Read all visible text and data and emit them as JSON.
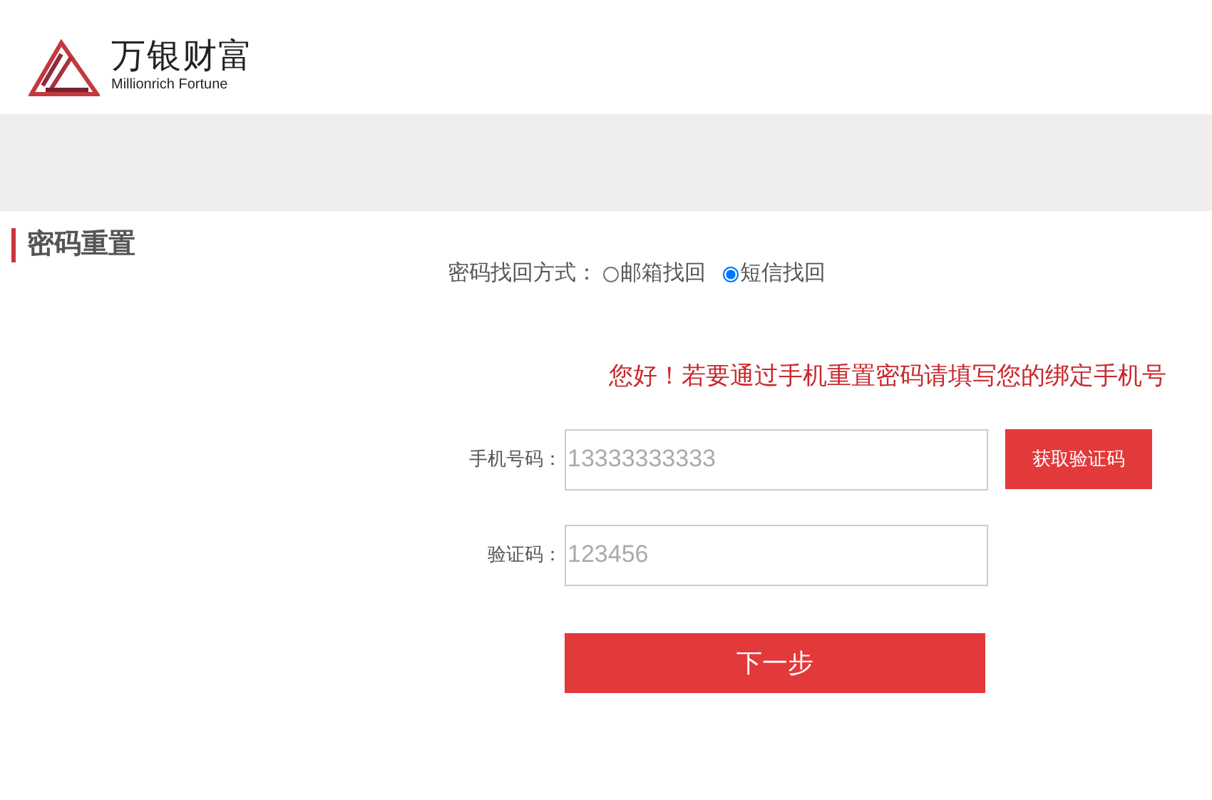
{
  "logo": {
    "name": "万银财富",
    "subtitle": "Millionrich Fortune"
  },
  "page_title": "密码重置",
  "recovery": {
    "label": "密码找回方式：",
    "options": [
      {
        "label": "邮箱找回",
        "selected": false
      },
      {
        "label": "短信找回",
        "selected": true
      }
    ]
  },
  "message": "您好！若要通过手机重置密码请填写您的绑定手机号",
  "fields": [
    {
      "label": "手机号码：",
      "placeholder": "13333333333",
      "button": "获取验证码"
    },
    {
      "label": "验证码：",
      "placeholder": "123456"
    }
  ],
  "submit": "下一步"
}
